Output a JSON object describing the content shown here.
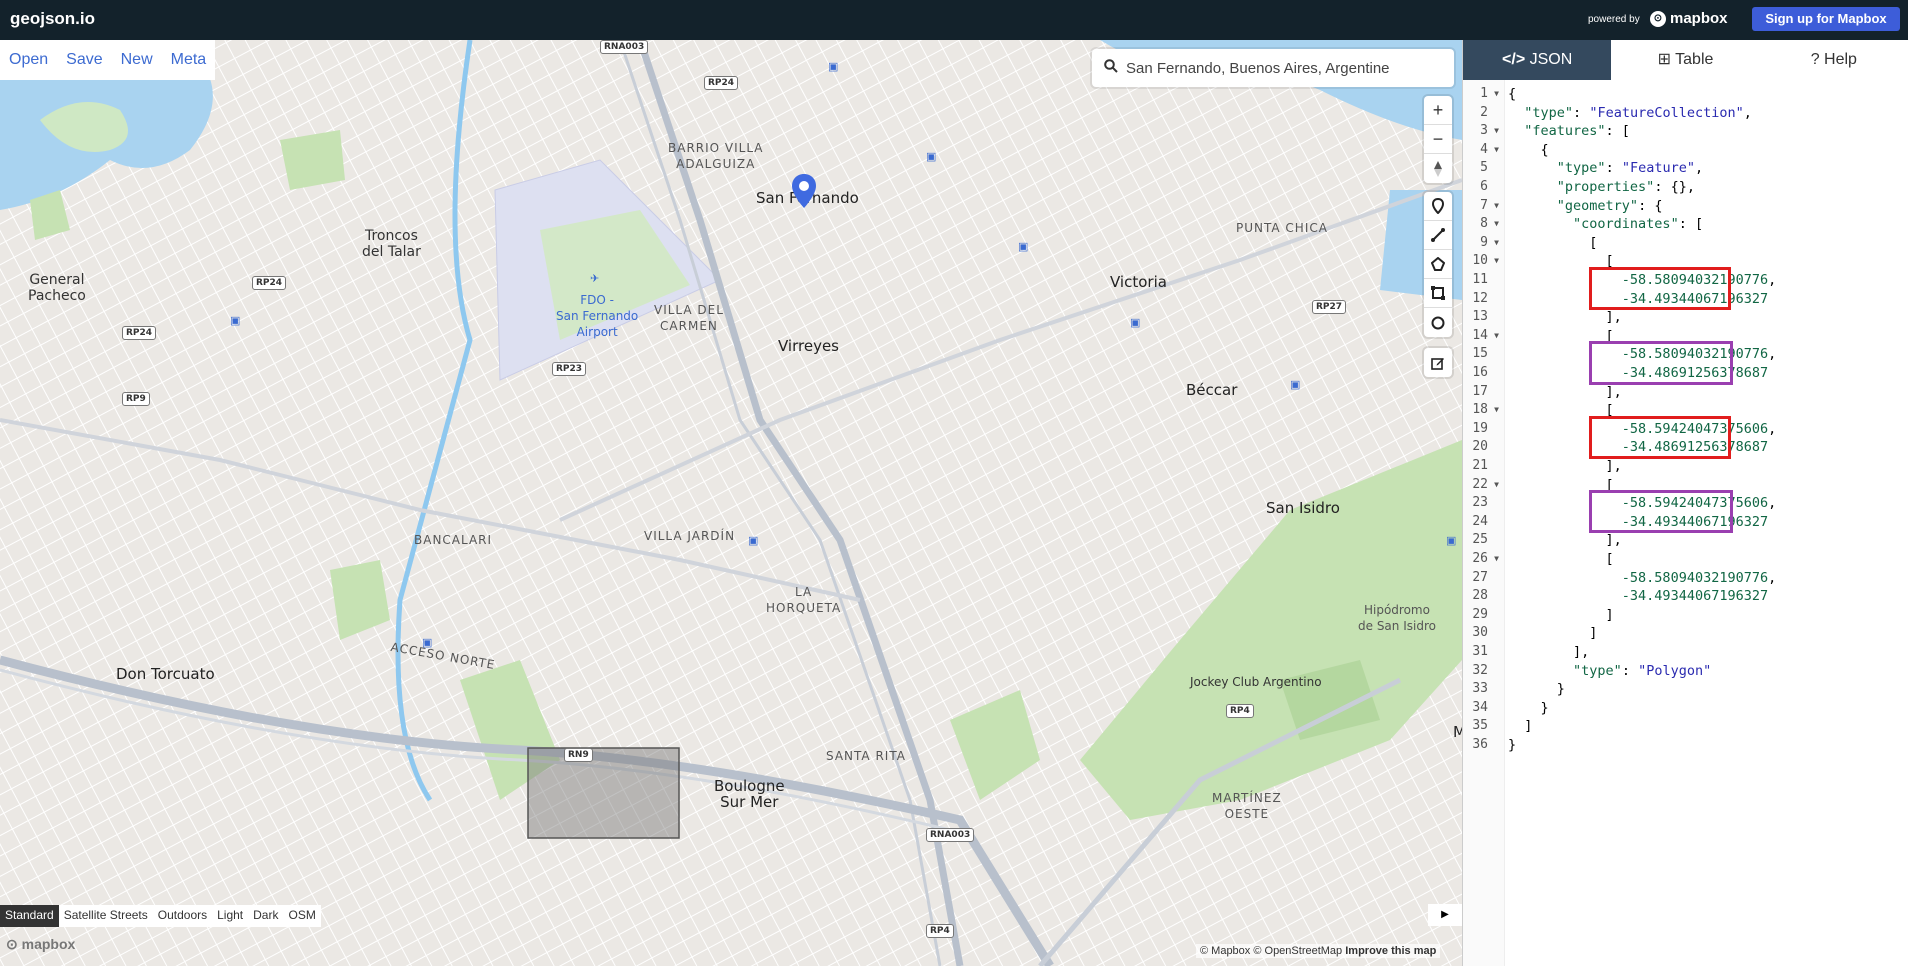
{
  "app": {
    "logo": "geojson.io",
    "powered_by": "powered by",
    "mapbox_brand": "mapbox",
    "signup": "Sign up for Mapbox"
  },
  "menu": {
    "items": [
      "Open",
      "Save",
      "New",
      "Meta"
    ]
  },
  "search": {
    "value": "San Fernando, Buenos Aires, Argentine"
  },
  "map_controls": {
    "zoom_in": "+",
    "zoom_out": "−",
    "draw_tools": [
      "marker-icon",
      "line-icon",
      "polygon-icon",
      "rectangle-icon",
      "circle-icon"
    ],
    "edit_tool": "edit-icon"
  },
  "map_labels": {
    "places": [
      "General Pacheco",
      "Troncos del Talar",
      "BARRIO VILLA ADALGUIZA",
      "San Fernando",
      "FDO - San Fernando Airport",
      "VILLA DEL CARMEN",
      "Virreyes",
      "Victoria",
      "PUNTA CHICA",
      "Béccar",
      "San Isidro",
      "BANCALARI",
      "VILLA JARDÍN",
      "LA HORQUETA",
      "Don Torcuato",
      "ACCESO NORTE",
      "Jockey Club Argentino",
      "Hipódromo de San Isidro",
      "SANTA RITA",
      "Boulogne Sur Mer",
      "MARTÍNEZ OESTE",
      "M"
    ],
    "roads": [
      "RNA003",
      "RP24",
      "RP24",
      "RP24",
      "RP9",
      "RP23",
      "RP27",
      "RN9",
      "RNA003",
      "RP4",
      "RP4"
    ]
  },
  "map_styles": {
    "items": [
      "Standard",
      "Satellite Streets",
      "Outdoors",
      "Light",
      "Dark",
      "OSM"
    ],
    "active": "Standard"
  },
  "attribution": {
    "text": "© Mapbox © OpenStreetMap",
    "improve": "Improve this map",
    "logo": "mapbox"
  },
  "panel": {
    "tabs": [
      {
        "label": "JSON",
        "icon": "code-icon",
        "active": true
      },
      {
        "label": "Table",
        "icon": "table-icon",
        "active": false
      },
      {
        "label": "Help",
        "icon": "help-icon",
        "active": false
      }
    ]
  },
  "editor": {
    "lines": [
      {
        "n": "1",
        "fold": true,
        "text": "{"
      },
      {
        "n": "2",
        "fold": false,
        "text": "  \"type\": \"FeatureCollection\","
      },
      {
        "n": "3",
        "fold": true,
        "text": "  \"features\": ["
      },
      {
        "n": "4",
        "fold": true,
        "text": "    {"
      },
      {
        "n": "5",
        "fold": false,
        "text": "      \"type\": \"Feature\","
      },
      {
        "n": "6",
        "fold": false,
        "text": "      \"properties\": {},"
      },
      {
        "n": "7",
        "fold": true,
        "text": "      \"geometry\": {"
      },
      {
        "n": "8",
        "fold": true,
        "text": "        \"coordinates\": ["
      },
      {
        "n": "9",
        "fold": true,
        "text": "          ["
      },
      {
        "n": "10",
        "fold": true,
        "text": "            ["
      },
      {
        "n": "11",
        "fold": false,
        "text": "              -58.58094032190776,"
      },
      {
        "n": "12",
        "fold": false,
        "text": "              -34.49344067196327"
      },
      {
        "n": "13",
        "fold": false,
        "text": "            ],"
      },
      {
        "n": "14",
        "fold": true,
        "text": "            ["
      },
      {
        "n": "15",
        "fold": false,
        "text": "              -58.58094032190776,"
      },
      {
        "n": "16",
        "fold": false,
        "text": "              -34.48691256378687"
      },
      {
        "n": "17",
        "fold": false,
        "text": "            ],"
      },
      {
        "n": "18",
        "fold": true,
        "text": "            ["
      },
      {
        "n": "19",
        "fold": false,
        "text": "              -58.59424047375606,"
      },
      {
        "n": "20",
        "fold": false,
        "text": "              -34.48691256378687"
      },
      {
        "n": "21",
        "fold": false,
        "text": "            ],"
      },
      {
        "n": "22",
        "fold": true,
        "text": "            ["
      },
      {
        "n": "23",
        "fold": false,
        "text": "              -58.59424047375606,"
      },
      {
        "n": "24",
        "fold": false,
        "text": "              -34.49344067196327"
      },
      {
        "n": "25",
        "fold": false,
        "text": "            ],"
      },
      {
        "n": "26",
        "fold": true,
        "text": "            ["
      },
      {
        "n": "27",
        "fold": false,
        "text": "              -58.58094032190776,"
      },
      {
        "n": "28",
        "fold": false,
        "text": "              -34.49344067196327"
      },
      {
        "n": "29",
        "fold": false,
        "text": "            ]"
      },
      {
        "n": "30",
        "fold": false,
        "text": "          ]"
      },
      {
        "n": "31",
        "fold": false,
        "text": "        ],"
      },
      {
        "n": "32",
        "fold": false,
        "text": "        \"type\": \"Polygon\""
      },
      {
        "n": "33",
        "fold": false,
        "text": "      }"
      },
      {
        "n": "34",
        "fold": false,
        "text": "    }"
      },
      {
        "n": "35",
        "fold": false,
        "text": "  ]"
      },
      {
        "n": "36",
        "fold": false,
        "text": "}"
      }
    ],
    "highlights": [
      {
        "lines": [
          11,
          12
        ],
        "color": "#e11d1d"
      },
      {
        "lines": [
          15,
          16
        ],
        "color": "#9a3fb0"
      },
      {
        "lines": [
          19,
          20
        ],
        "color": "#e11d1d"
      },
      {
        "lines": [
          23,
          24
        ],
        "color": "#9a3fb0"
      }
    ]
  },
  "colors": {
    "topbar": "#13222b",
    "signup": "#3d5dd9",
    "tab_active": "#34495e",
    "link": "#3d6bd1",
    "marker": "#3f6ae0"
  }
}
